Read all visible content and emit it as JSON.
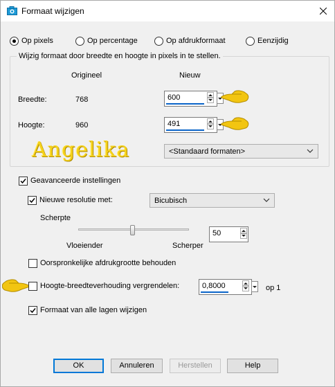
{
  "window": {
    "title": "Formaat wijzigen"
  },
  "mode": {
    "options": [
      "Op pixels",
      "Op percentage",
      "Op afdrukformaat",
      "Eenzijdig"
    ],
    "selected": "Op pixels"
  },
  "pixel_group": {
    "title": "Wijzig formaat door breedte en hoogte in pixels in te stellen.",
    "col_original": "Origineel",
    "col_new": "Nieuw",
    "width_label": "Breedte:",
    "width_original": "768",
    "width_new": "600",
    "height_label": "Hoogte:",
    "height_original": "960",
    "height_new": "491",
    "preset_select": "<Standaard formaten>"
  },
  "watermark": "Angelika",
  "advanced": {
    "label": "Geavanceerde instellingen",
    "checked": true,
    "new_resolution_label": "Nieuwe resolutie met:",
    "new_resolution_checked": true,
    "resample_method": "Bicubisch",
    "sharpness_label": "Scherpte",
    "sharpness_min_label": "Vloeiender",
    "sharpness_max_label": "Scherper",
    "sharpness_value": "50",
    "keep_print_size_label": "Oorspronkelijke afdrukgrootte behouden",
    "keep_print_size_checked": false,
    "lock_aspect_label": "Hoogte-breedteverhouding vergrendelen:",
    "lock_aspect_checked": false,
    "aspect_value": "0,8000",
    "aspect_suffix": "op 1",
    "all_layers_label": "Formaat van alle lagen wijzigen",
    "all_layers_checked": true
  },
  "buttons": {
    "ok": "OK",
    "cancel": "Annuleren",
    "reset": "Herstellen",
    "help": "Help"
  },
  "colors": {
    "accent": "#0078d7",
    "pointer_hand": "#f2c511",
    "watermark": "#f5d21a"
  }
}
